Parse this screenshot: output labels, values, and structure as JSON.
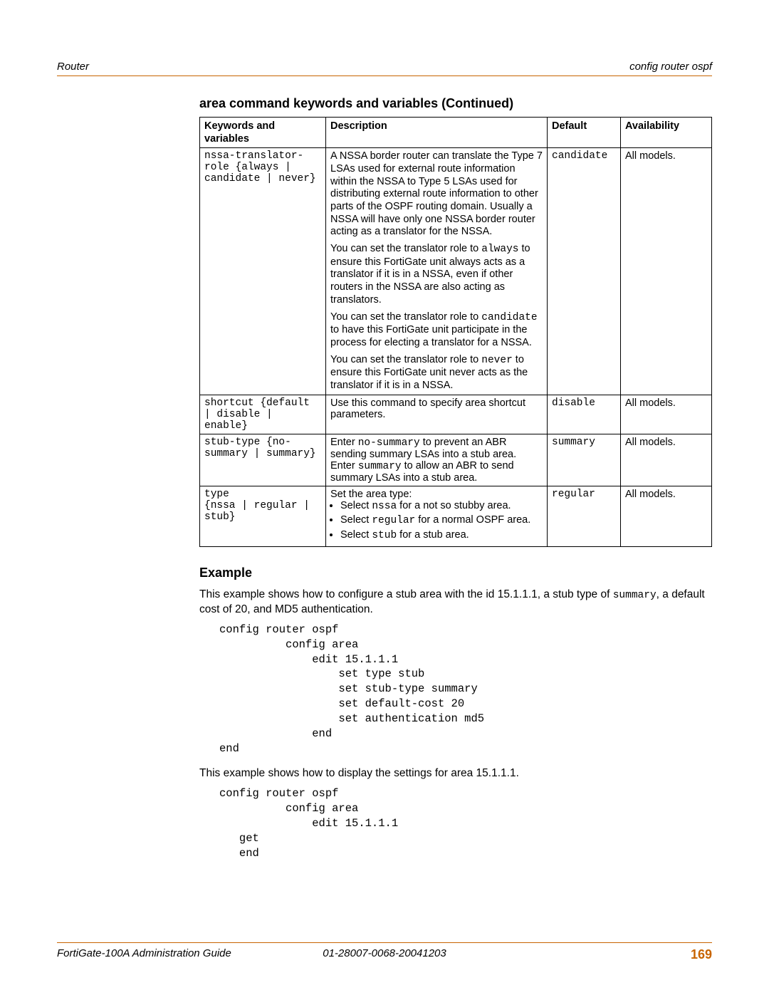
{
  "header": {
    "left": "Router",
    "right": "config router ospf"
  },
  "section_title": "area command keywords and variables (Continued)",
  "table": {
    "headers": {
      "col1a": "Keywords and",
      "col1b": "variables",
      "col2": "Description",
      "col3": "Default",
      "col4": "Availability"
    },
    "rows": [
      {
        "keyword": "nssa-translator-role {always | candidate | never}",
        "desc_p1_a": "A NSSA border router can translate the Type 7 LSAs used for external route information within the NSSA to Type 5 LSAs used for distributing external route information to other parts of the OSPF routing domain. Usually a NSSA will have only one NSSA border router acting as a translator for the NSSA.",
        "desc_p2_a": "You can set the translator role to ",
        "desc_p2_code": "always",
        "desc_p2_b": " to ensure this FortiGate unit always acts as a translator if it is in a NSSA, even if other routers in the NSSA are also acting as translators.",
        "desc_p3_a": "You can set the translator role to ",
        "desc_p3_code": "candidate",
        "desc_p3_b": " to have this FortiGate unit participate in the process for electing a translator for a NSSA.",
        "desc_p4_a": "You can set the translator role to ",
        "desc_p4_code": "never",
        "desc_p4_b": " to ensure this FortiGate unit never acts as the translator if it is in a NSSA.",
        "default": "candidate",
        "avail": "All models."
      },
      {
        "keyword": "shortcut {default | disable | enable}",
        "desc": "Use this command to specify area shortcut parameters.",
        "default": "disable",
        "avail": "All models."
      },
      {
        "keyword": "stub-type {no-summary | summary}",
        "desc_a": "Enter ",
        "desc_code1": "no-summary",
        "desc_b": " to prevent an ABR sending summary LSAs into a stub area. Enter ",
        "desc_code2": "summary",
        "desc_c": " to allow an ABR to send summary LSAs into a stub area.",
        "default": "summary",
        "avail": "All models."
      },
      {
        "keyword": "type\n{nssa | regular | stub}",
        "desc_head": "Set the area type:",
        "b1_a": "Select ",
        "b1_code": "nssa",
        "b1_b": " for a not so stubby area.",
        "b2_a": "Select ",
        "b2_code": "regular",
        "b2_b": " for a normal OSPF area.",
        "b3_a": "Select ",
        "b3_code": "stub",
        "b3_b": " for a stub area.",
        "default": "regular",
        "avail": "All models."
      }
    ]
  },
  "example": {
    "heading": "Example",
    "p1_a": "This example shows how to configure a stub area with the id 15.1.1.1, a stub type of ",
    "p1_code": "summary",
    "p1_b": ", a default cost of 20, and MD5 authentication.",
    "code1": "config router ospf\n          config area\n              edit 15.1.1.1\n                  set type stub\n                  set stub-type summary\n                  set default-cost 20\n                  set authentication md5\n              end\nend",
    "p2": "This example shows how to display the settings for area 15.1.1.1.",
    "code2": "config router ospf\n          config area\n              edit 15.1.1.1\n   get\n   end"
  },
  "footer": {
    "left": "FortiGate-100A Administration Guide",
    "center": "01-28007-0068-20041203",
    "page": "169"
  }
}
